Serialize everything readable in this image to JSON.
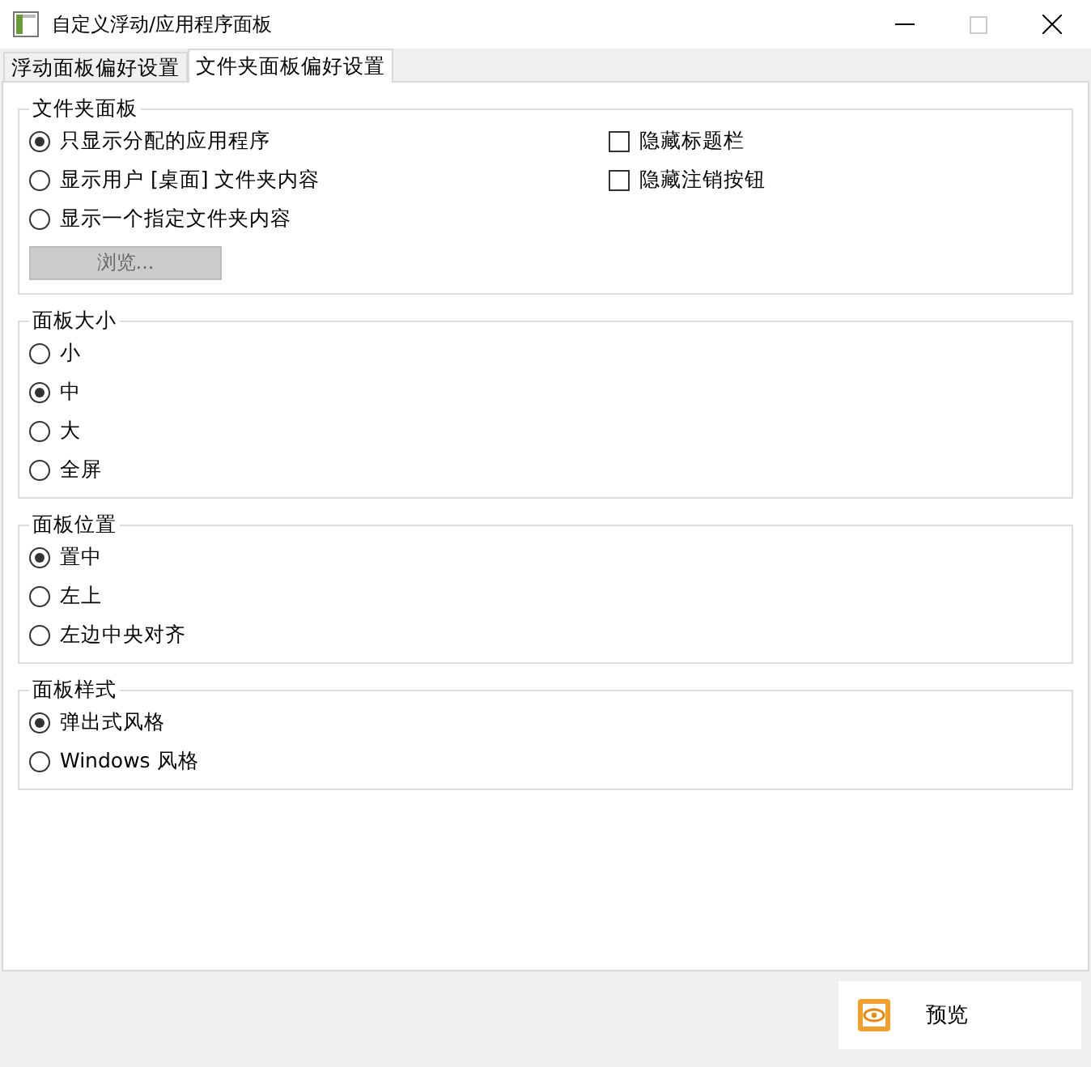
{
  "window": {
    "title": "自定义浮动/应用程序面板"
  },
  "tabs": [
    {
      "label": "浮动面板偏好设置",
      "selected": false
    },
    {
      "label": "文件夹面板偏好设置",
      "selected": true
    }
  ],
  "groups": [
    {
      "title": "文件夹面板",
      "options": [
        {
          "kind": "radio",
          "label": "只显示分配的应用程序",
          "selected": true
        },
        {
          "kind": "radio",
          "label": "显示用户 [桌面] 文件夹内容",
          "selected": false
        },
        {
          "kind": "radio",
          "label": "显示一个指定文件夹内容",
          "selected": false
        },
        {
          "kind": "checkbox",
          "label": "隐藏标题栏",
          "checked": false
        },
        {
          "kind": "checkbox",
          "label": "隐藏注销按钮",
          "checked": false
        }
      ],
      "button": {
        "label": "浏览...",
        "disabled": true
      }
    },
    {
      "title": "面板大小",
      "options": [
        {
          "kind": "radio",
          "label": "小",
          "selected": false
        },
        {
          "kind": "radio",
          "label": "中",
          "selected": true
        },
        {
          "kind": "radio",
          "label": "大",
          "selected": false
        },
        {
          "kind": "radio",
          "label": "全屏",
          "selected": false
        }
      ]
    },
    {
      "title": "面板位置",
      "options": [
        {
          "kind": "radio",
          "label": "置中",
          "selected": true
        },
        {
          "kind": "radio",
          "label": "左上",
          "selected": false
        },
        {
          "kind": "radio",
          "label": "左边中央对齐",
          "selected": false
        }
      ]
    },
    {
      "title": "面板样式",
      "options": [
        {
          "kind": "radio",
          "label": "弹出式风格",
          "selected": true
        },
        {
          "kind": "radio",
          "label": "Windows 风格",
          "selected": false
        }
      ]
    }
  ],
  "footer": {
    "button": "预览"
  }
}
